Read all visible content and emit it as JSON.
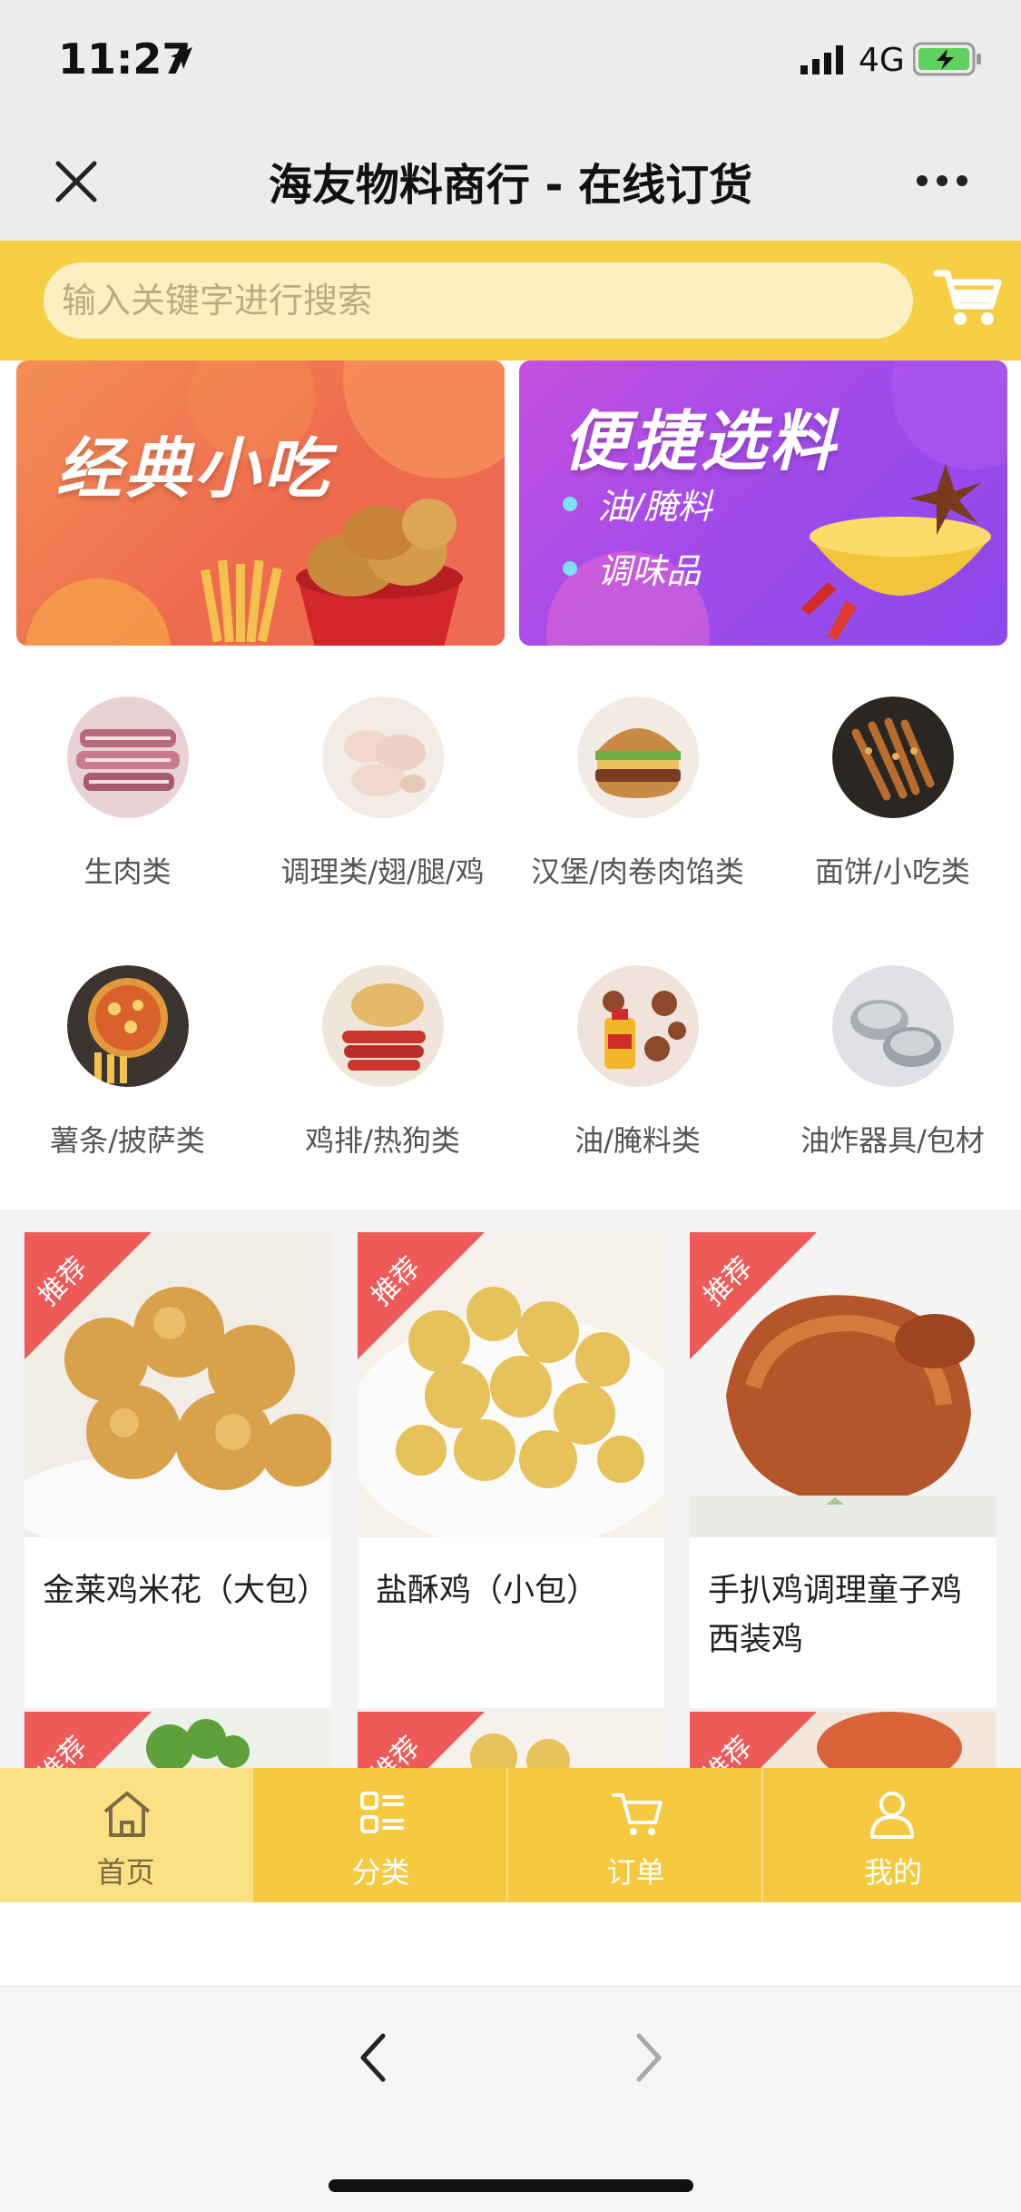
{
  "status_bar": {
    "time": "11:27",
    "network": "4G"
  },
  "nav": {
    "title": "海友物料商行 - 在线订货"
  },
  "search": {
    "placeholder": "输入关键字进行搜索"
  },
  "banners": [
    {
      "title": "经典小吃",
      "bullets": []
    },
    {
      "title": "便捷选料",
      "bullets": [
        "油/腌料",
        "调味品"
      ]
    }
  ],
  "categories": [
    {
      "label": "生肉类",
      "icon": "raw-meat-image"
    },
    {
      "label": "调理类/翅/腿/鸡",
      "icon": "chicken-wings-image"
    },
    {
      "label": "汉堡/肉卷肉馅类",
      "icon": "burger-image"
    },
    {
      "label": "面饼/小吃类",
      "icon": "skewers-image"
    },
    {
      "label": "薯条/披萨类",
      "icon": "pizza-image"
    },
    {
      "label": "鸡排/热狗类",
      "icon": "hotdog-image"
    },
    {
      "label": "油/腌料类",
      "icon": "oil-image"
    },
    {
      "label": "油炸器具/包材",
      "icon": "fryer-image"
    }
  ],
  "products": [
    {
      "badge": "推荐",
      "name": "金莱鸡米花（大包）"
    },
    {
      "badge": "推荐",
      "name": "盐酥鸡（小包）"
    },
    {
      "badge": "推荐",
      "name": "手扒鸡调理童子鸡西装鸡"
    }
  ],
  "products_row2": [
    {
      "badge": "推荐"
    },
    {
      "badge": "推荐"
    },
    {
      "badge": "推荐"
    }
  ],
  "tabbar": [
    {
      "label": "首页",
      "icon": "home-icon",
      "active": true
    },
    {
      "label": "分类",
      "icon": "category-icon",
      "active": false
    },
    {
      "label": "订单",
      "icon": "cart-icon",
      "active": false
    },
    {
      "label": "我的",
      "icon": "user-icon",
      "active": false
    }
  ],
  "colors": {
    "accent": "#f7cf45",
    "ribbon": "#ee5a58",
    "tab_active": "#fbe183"
  }
}
